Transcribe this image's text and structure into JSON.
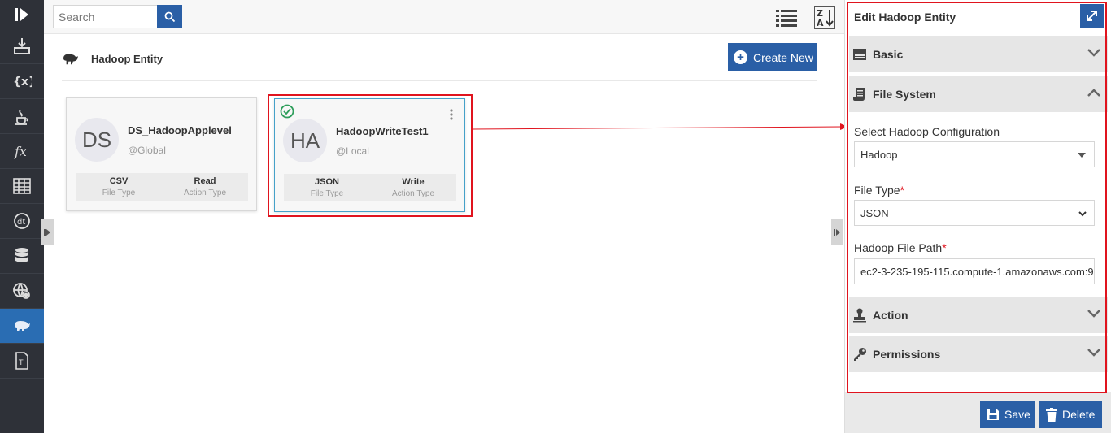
{
  "search": {
    "placeholder": "Search"
  },
  "page": {
    "title": "Hadoop Entity",
    "create_label": "Create New"
  },
  "cards": [
    {
      "initials": "DS",
      "name": "DS_HadoopApplevel",
      "scope": "@Global",
      "file_type": "CSV",
      "file_type_label": "File Type",
      "action_type": "Read",
      "action_type_label": "Action Type"
    },
    {
      "initials": "HA",
      "name": "HadoopWriteTest1",
      "scope": "@Local",
      "file_type": "JSON",
      "file_type_label": "File Type",
      "action_type": "Write",
      "action_type_label": "Action Type"
    }
  ],
  "panel": {
    "title": "Edit Hadoop Entity",
    "sections": {
      "basic": "Basic",
      "file_system": "File System",
      "action": "Action",
      "permissions": "Permissions"
    },
    "fields": {
      "config_label": "Select Hadoop Configuration",
      "config_value": "Hadoop",
      "file_type_label": "File Type",
      "file_type_value": "JSON",
      "path_label": "Hadoop File Path",
      "path_value": "ec2-3-235-195-115.compute-1.amazonaws.com:9",
      "required_mark": "*"
    },
    "save_label": "Save",
    "delete_label": "Delete"
  },
  "colors": {
    "accent": "#2a5fa6",
    "rail": "#2e3138",
    "highlight": "#e0141e",
    "success": "#2e9e5b"
  }
}
